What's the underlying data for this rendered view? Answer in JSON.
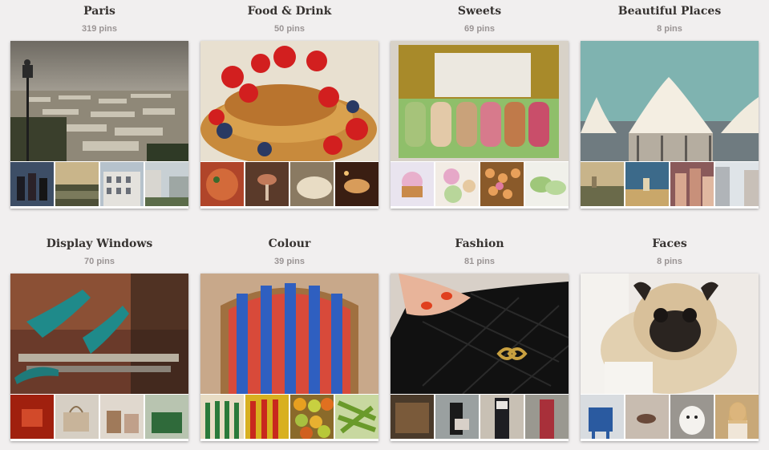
{
  "boards": [
    {
      "title": "Paris",
      "count": "319 pins"
    },
    {
      "title": "Food & Drink",
      "count": "50 pins"
    },
    {
      "title": "Sweets",
      "count": "69 pins"
    },
    {
      "title": "Beautiful Places",
      "count": "8 pins"
    },
    {
      "title": "Display Windows",
      "count": "70 pins"
    },
    {
      "title": "Colour",
      "count": "39 pins"
    },
    {
      "title": "Fashion",
      "count": "81 pins"
    },
    {
      "title": "Faces",
      "count": "8 pins"
    }
  ],
  "colors": {
    "page_background": "#f1efef",
    "title_text": "#363230",
    "count_text": "#9a9494"
  }
}
